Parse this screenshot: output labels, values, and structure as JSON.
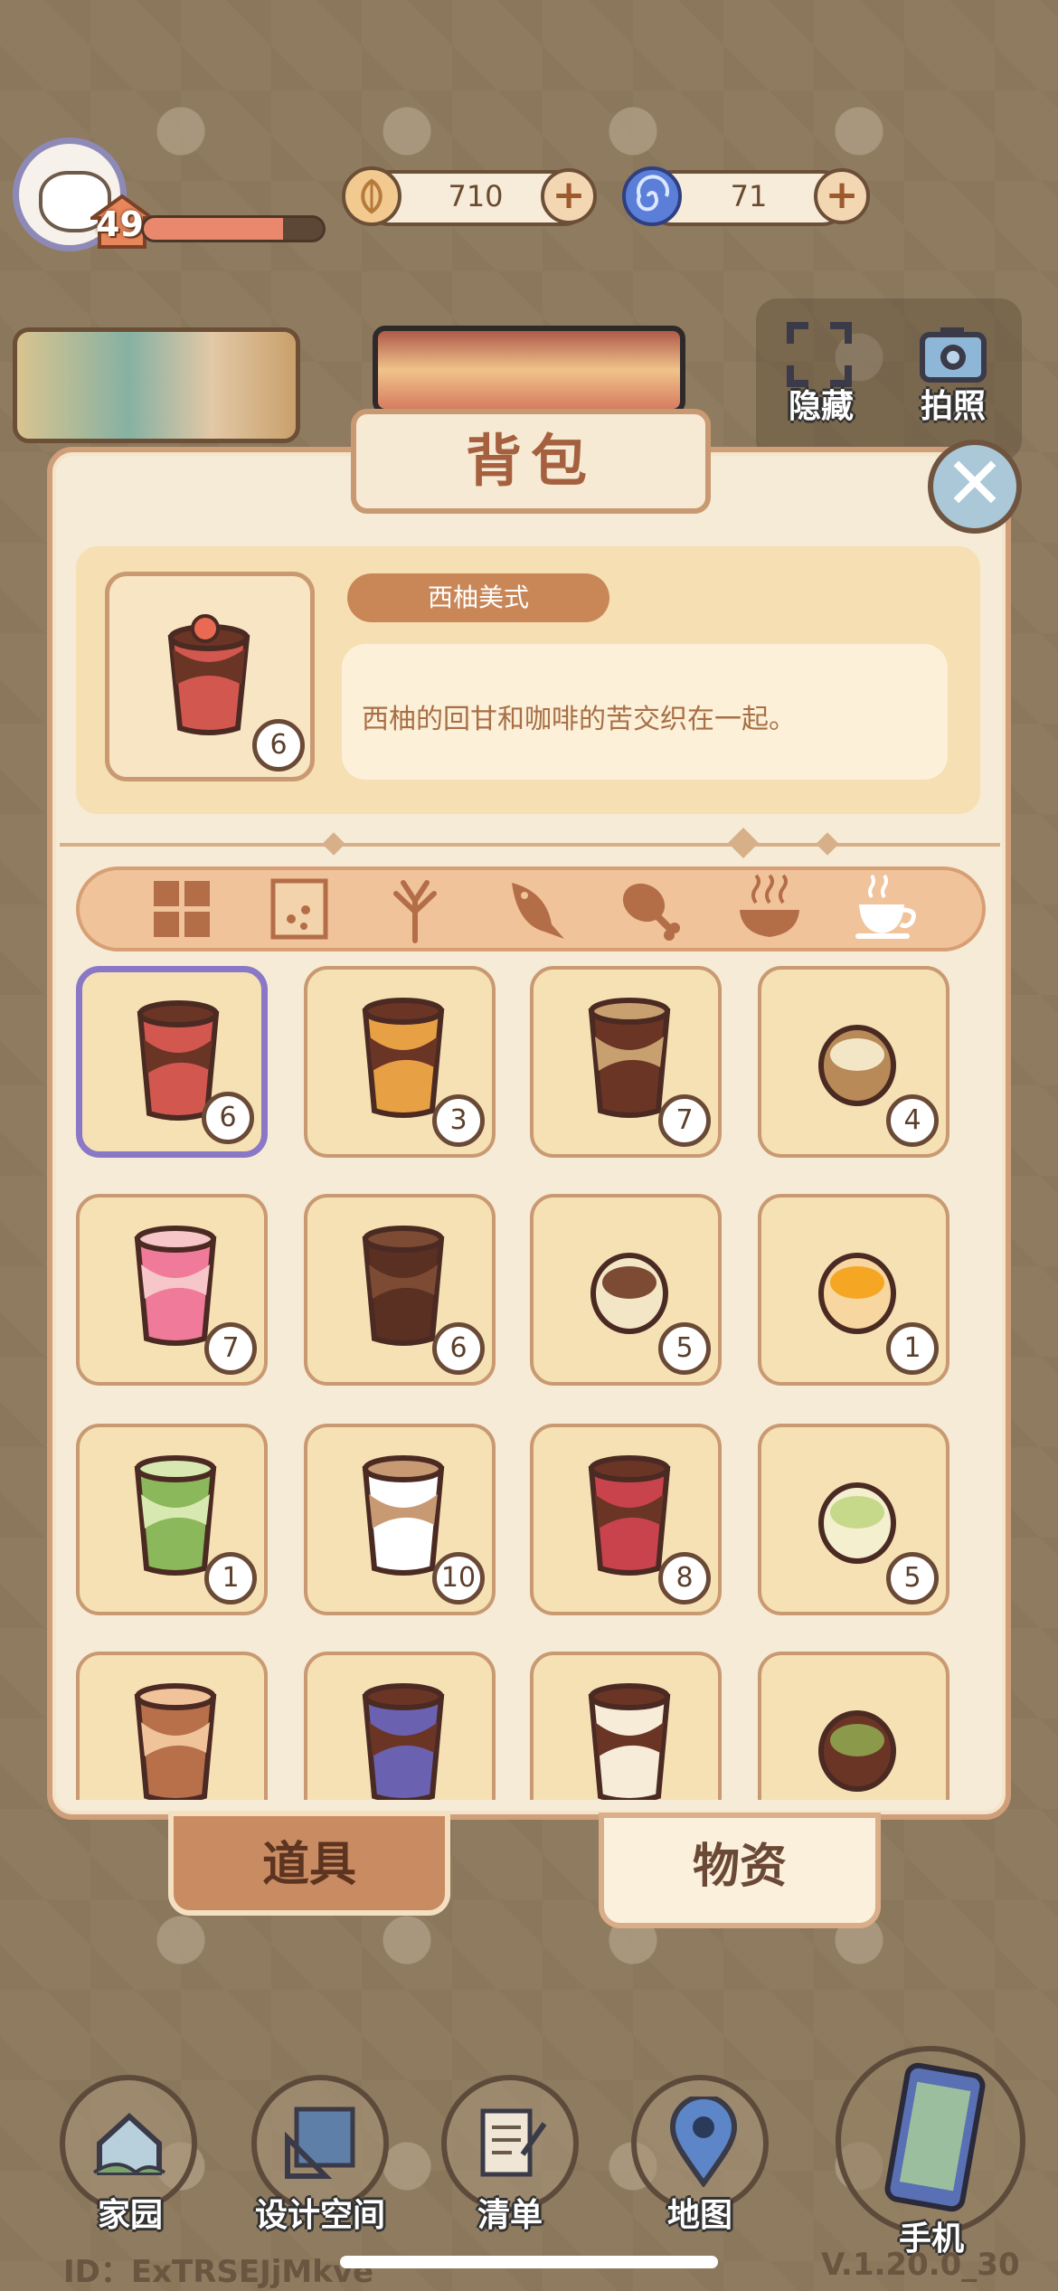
{
  "player": {
    "level": "49",
    "xp_progress": 0.78
  },
  "currency": {
    "coins": "710",
    "swirl": "71"
  },
  "tools": {
    "hide_label": "隐藏",
    "photo_label": "拍照"
  },
  "panel": {
    "title": "背包"
  },
  "selected": {
    "name": "西柚美式",
    "description": "西柚的回甘和咖啡的苦交织在一起。",
    "count": "6"
  },
  "categories": [
    "all-grid-icon",
    "seed-bag-icon",
    "plant-icon",
    "fish-icon",
    "meat-icon",
    "soup-icon",
    "coffee-cup-icon"
  ],
  "items": [
    {
      "count": "6",
      "icon": "grapefruit-americano-icon",
      "selected": true
    },
    {
      "count": "3",
      "icon": "orange-coffee-icon"
    },
    {
      "count": "7",
      "icon": "cinnamon-coffee-icon"
    },
    {
      "count": "4",
      "icon": "latte-orb-icon"
    },
    {
      "count": "7",
      "icon": "fruit-smoothie-icon"
    },
    {
      "count": "6",
      "icon": "iced-coffee-icon"
    },
    {
      "count": "5",
      "icon": "coffee-orb-icon"
    },
    {
      "count": "1",
      "icon": "mango-coffee-icon"
    },
    {
      "count": "1",
      "icon": "matcha-float-icon"
    },
    {
      "count": "10",
      "icon": "latte-cup-icon"
    },
    {
      "count": "8",
      "icon": "berry-coffee-icon"
    },
    {
      "count": "5",
      "icon": "matcha-latte-icon"
    },
    {
      "count": "",
      "icon": "caramel-coffee-icon"
    },
    {
      "count": "",
      "icon": "blueberry-coffee-icon"
    },
    {
      "count": "",
      "icon": "cream-coffee-icon"
    },
    {
      "count": "",
      "icon": "matcha-layer-icon"
    }
  ],
  "tabs": {
    "items": "道具",
    "goods": "物资"
  },
  "nav": {
    "home": "家园",
    "design": "设计空间",
    "list": "清单",
    "map": "地图",
    "phone": "手机"
  },
  "footer": {
    "id": "ID：ExTRSEJjMkve",
    "version": "V.1.20.0_30"
  },
  "colors": {
    "accent": "#c98758",
    "selection": "#8a78c7",
    "panel": "#f6ebd7"
  }
}
